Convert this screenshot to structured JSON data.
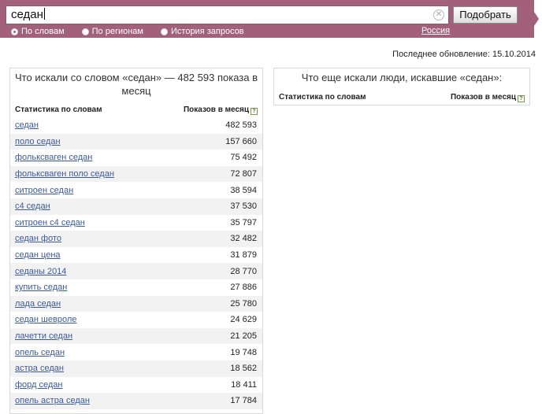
{
  "search": {
    "query": "седан",
    "button_label": "Подобрать"
  },
  "tabs": [
    {
      "label": "По словам",
      "selected": true
    },
    {
      "label": "По регионам",
      "selected": false
    },
    {
      "label": "История запросов",
      "selected": false
    }
  ],
  "region": "Россия",
  "last_update": "Последнее обновление: 15.10.2014",
  "left_panel": {
    "title": "Что искали со словом «седан» — 482 593 показа в месяц",
    "col_keyword": "Статистика по словам",
    "col_count": "Показов в месяц",
    "rows": [
      {
        "keyword": "седан",
        "count": "482 593"
      },
      {
        "keyword": "поло седан",
        "count": "157 660"
      },
      {
        "keyword": "фольксваген седан",
        "count": "75 492"
      },
      {
        "keyword": "фольксваген поло седан",
        "count": "72 807"
      },
      {
        "keyword": "ситроен седан",
        "count": "38 594"
      },
      {
        "keyword": "с4 седан",
        "count": "37 530"
      },
      {
        "keyword": "ситроен с4 седан",
        "count": "35 797"
      },
      {
        "keyword": "седан фото",
        "count": "32 482"
      },
      {
        "keyword": "седан цена",
        "count": "31 879"
      },
      {
        "keyword": "седаны 2014",
        "count": "28 770"
      },
      {
        "keyword": "купить седан",
        "count": "27 886"
      },
      {
        "keyword": "лада седан",
        "count": "25 780"
      },
      {
        "keyword": "седан шевроле",
        "count": "24 629"
      },
      {
        "keyword": "лачетти седан",
        "count": "21 205"
      },
      {
        "keyword": "опель седан",
        "count": "19 748"
      },
      {
        "keyword": "астра седан",
        "count": "18 562"
      },
      {
        "keyword": "форд седан",
        "count": "18 411"
      },
      {
        "keyword": "опель астра седан",
        "count": "17 784"
      }
    ]
  },
  "right_panel": {
    "title": "Что еще искали люди, искавшие «седан»:",
    "col_keyword": "Статистика по словам",
    "col_count": "Показов в месяц"
  },
  "colors": {
    "banner": "#a26178",
    "link": "#3b5a9a",
    "row_alt": "#f2f2f2"
  },
  "icons": {
    "clear": "clear-icon",
    "help": "help-icon"
  }
}
